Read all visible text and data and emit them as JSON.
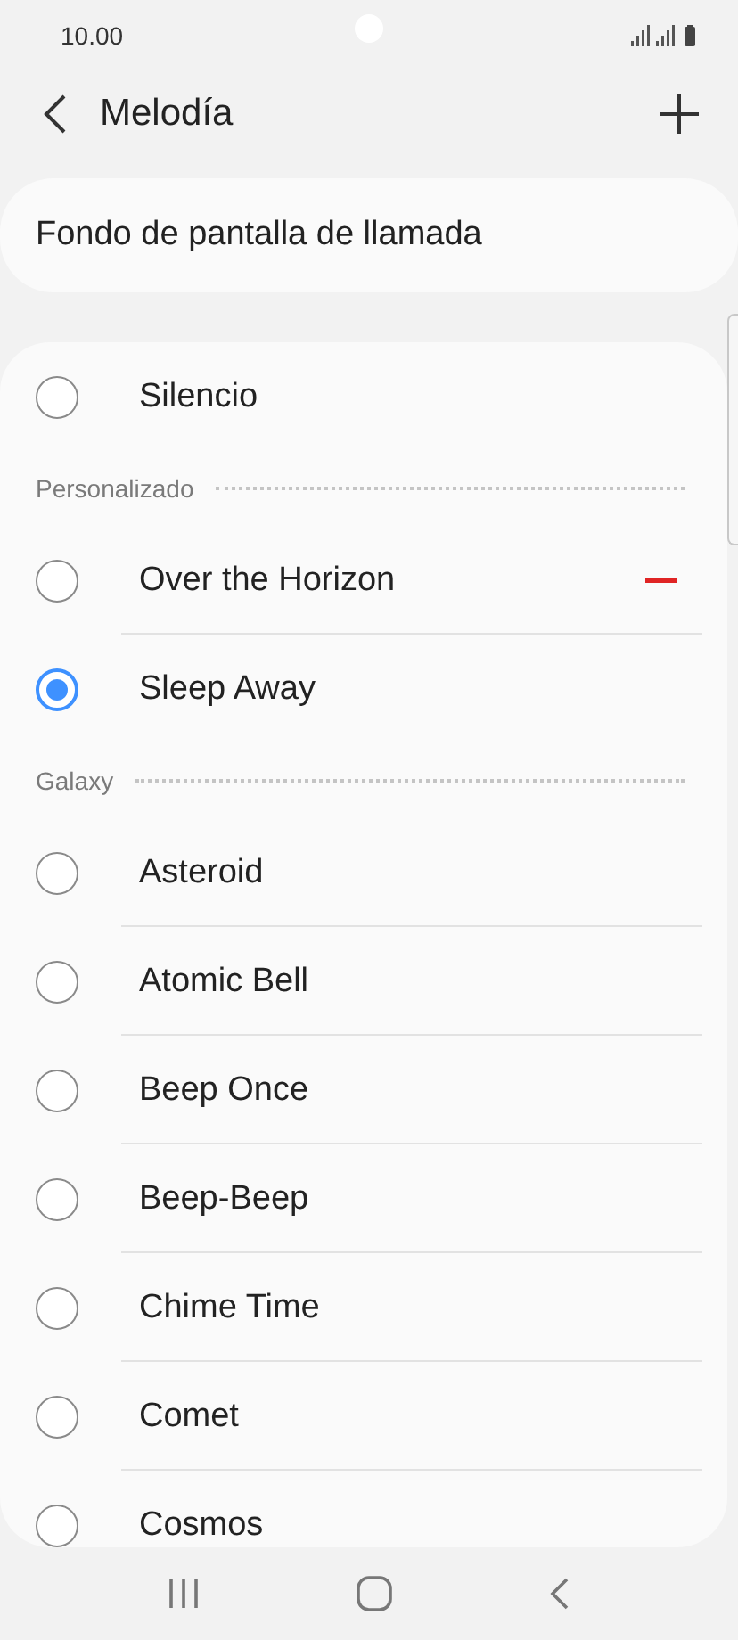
{
  "status_bar": {
    "time": "10.00"
  },
  "header": {
    "title": "Melodía"
  },
  "wallpaper_option": {
    "label": "Fondo de pantalla de llamada"
  },
  "list": [
    {
      "kind": "radio",
      "label": "Silencio",
      "selected": false
    },
    {
      "kind": "header",
      "label": "Personalizado"
    },
    {
      "kind": "radio",
      "label": "Over the Horizon",
      "selected": false,
      "removable": true
    },
    {
      "kind": "radio",
      "label": "Sleep Away",
      "selected": true
    },
    {
      "kind": "header",
      "label": "Galaxy"
    },
    {
      "kind": "radio",
      "label": "Asteroid",
      "selected": false
    },
    {
      "kind": "radio",
      "label": "Atomic Bell",
      "selected": false
    },
    {
      "kind": "radio",
      "label": "Beep Once",
      "selected": false
    },
    {
      "kind": "radio",
      "label": "Beep-Beep",
      "selected": false
    },
    {
      "kind": "radio",
      "label": "Chime Time",
      "selected": false
    },
    {
      "kind": "radio",
      "label": "Comet",
      "selected": false
    },
    {
      "kind": "radio",
      "label": "Cosmos",
      "selected": false
    }
  ]
}
